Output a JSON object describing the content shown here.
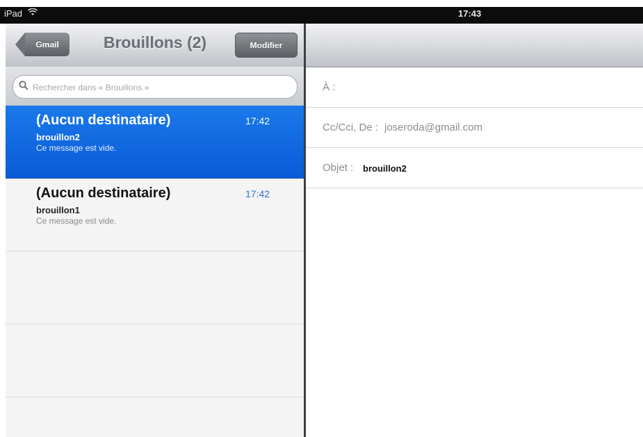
{
  "status_bar": {
    "device": "iPad",
    "wifi_icon": "wifi-icon",
    "time": "17:43"
  },
  "left_pane": {
    "back_button": "Gmail",
    "title": "Brouillons (2)",
    "edit_button": "Modifier",
    "search": {
      "placeholder": "Rechercher dans « Brouillons »",
      "icon": "search-icon"
    },
    "messages": [
      {
        "to": "(Aucun destinataire)",
        "time": "17:42",
        "subject": "brouillon2",
        "preview": "Ce message est vide.",
        "selected": true
      },
      {
        "to": "(Aucun destinataire)",
        "time": "17:42",
        "subject": "brouillon1",
        "preview": "Ce message est vide.",
        "selected": false
      }
    ]
  },
  "right_pane": {
    "to_label": "À :",
    "cc_label": "Cc/Cci, De :",
    "cc_value": "joseroda@gmail.com",
    "subject_label": "Objet :",
    "subject_value": "brouillon2"
  },
  "colors": {
    "selection_blue": "#0a5bd7",
    "time_blue": "#2f6fd0"
  }
}
